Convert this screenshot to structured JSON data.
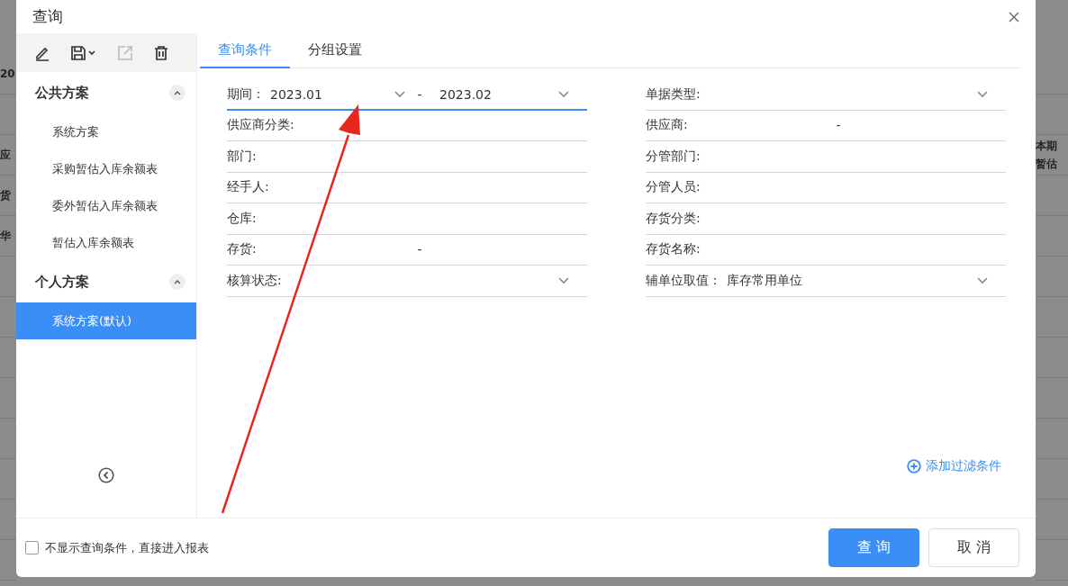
{
  "backdrop": {
    "left_texts": [
      "20",
      "应",
      "货",
      "华"
    ],
    "right_texts": [
      "本期",
      "暂估"
    ]
  },
  "dialog": {
    "title": "查询",
    "toolbar": [
      {
        "kind": "edit",
        "disabled": false
      },
      {
        "kind": "save",
        "disabled": false
      },
      {
        "kind": "export",
        "disabled": true
      },
      {
        "kind": "delete",
        "disabled": false
      }
    ],
    "scheme_groups": [
      {
        "title": "公共方案",
        "expanded": true,
        "items": [
          {
            "label": "系统方案",
            "selected": false
          },
          {
            "label": "采购暂估入库余额表",
            "selected": false
          },
          {
            "label": "委外暂估入库余额表",
            "selected": false
          },
          {
            "label": "暂估入库余额表",
            "selected": false
          }
        ]
      },
      {
        "title": "个人方案",
        "expanded": true,
        "items": [
          {
            "label": "系统方案(默认)",
            "selected": true
          }
        ]
      }
    ],
    "tabs": [
      {
        "label": "查询条件",
        "selected": true
      },
      {
        "label": "分组设置",
        "selected": false
      }
    ],
    "left_fields": [
      {
        "kind": "range-select",
        "label": "期间：",
        "from": "2023.01",
        "separator": "-",
        "to": "2023.02",
        "focused": true
      },
      {
        "kind": "text",
        "label": "供应商分类:",
        "focused": false
      },
      {
        "kind": "text",
        "label": "部门:",
        "focused": false
      },
      {
        "kind": "text",
        "label": "经手人:",
        "focused": false
      },
      {
        "kind": "text",
        "label": "仓库:",
        "focused": false
      },
      {
        "kind": "range-text",
        "label": "存货:",
        "separator": "-",
        "focused": false
      },
      {
        "kind": "select",
        "label": "核算状态:",
        "focused": false
      }
    ],
    "right_fields": [
      {
        "kind": "select",
        "label": "单据类型:",
        "focused": false
      },
      {
        "kind": "range-text",
        "label": "供应商:",
        "separator": "-",
        "focused": false
      },
      {
        "kind": "text",
        "label": "分管部门:",
        "focused": false
      },
      {
        "kind": "text",
        "label": "分管人员:",
        "focused": false
      },
      {
        "kind": "text",
        "label": "存货分类:",
        "focused": false
      },
      {
        "kind": "text",
        "label": "存货名称:",
        "focused": false
      },
      {
        "kind": "select",
        "label": "辅单位取值：",
        "value": "库存常用单位",
        "focused": false
      }
    ],
    "add_filter": "添加过滤条件",
    "skip_option": {
      "label": "不显示查询条件，直接进入报表",
      "checked": false
    },
    "buttons": [
      {
        "label": "查 询",
        "kind": "primary"
      },
      {
        "label": "取 消",
        "kind": "default"
      }
    ]
  }
}
